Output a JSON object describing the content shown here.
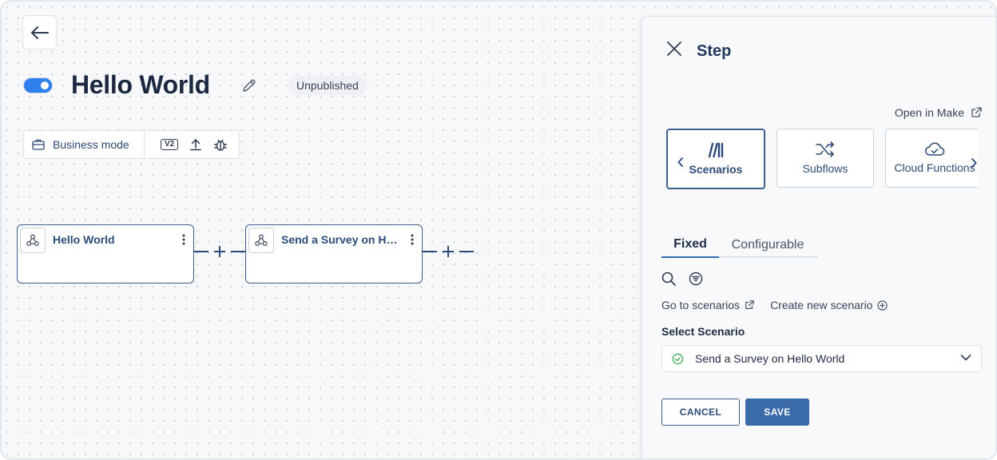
{
  "flow": {
    "title": "Hello World",
    "status": "Unpublished",
    "mode_label": "Business mode",
    "version_badge": "V2"
  },
  "nodes": [
    {
      "title": "Hello World"
    },
    {
      "title": "Send a Survey on Hello World"
    }
  ],
  "panel": {
    "title": "Step",
    "open_in_make": "Open in Make",
    "cards": [
      {
        "label": "Scenarios",
        "icon": "make-logo-icon",
        "active": true
      },
      {
        "label": "Subflows",
        "icon": "shuffle-icon",
        "active": false
      },
      {
        "label": "Cloud Functions",
        "icon": "cloud-check-icon",
        "active": false
      }
    ],
    "tabs": [
      {
        "label": "Fixed",
        "active": true
      },
      {
        "label": "Configurable",
        "active": false
      }
    ],
    "go_to_scenarios": "Go to scenarios",
    "create_new_scenario": "Create new scenario",
    "select_label": "Select Scenario",
    "selected_scenario": "Send a Survey on Hello World",
    "cancel_label": "CANCEL",
    "save_label": "SAVE"
  },
  "colors": {
    "accent": "#2f80ed",
    "primary_button": "#3a6aa8",
    "node_border": "#3d5d8a",
    "success": "#3aa856"
  }
}
